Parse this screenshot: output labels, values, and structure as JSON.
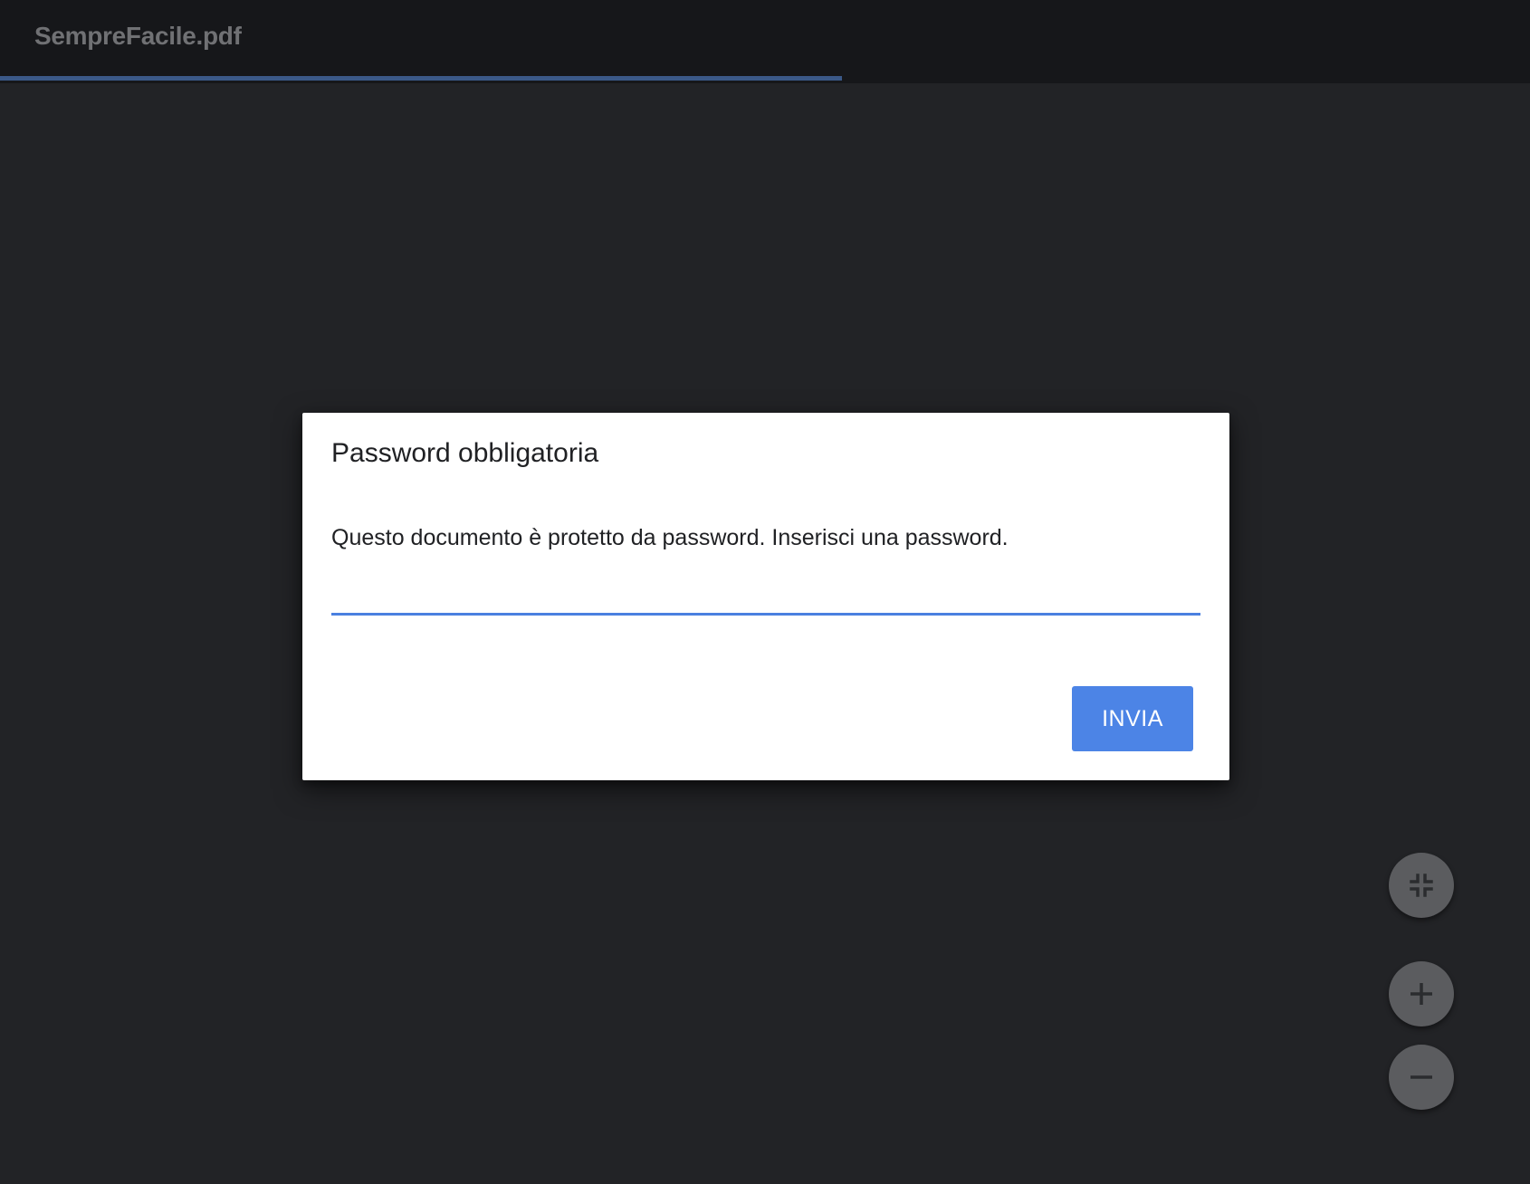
{
  "toolbar": {
    "document_title": "SempreFacile.pdf",
    "load_progress": 0.55,
    "progress_color": "#3b5988"
  },
  "dialog": {
    "title": "Password obbligatoria",
    "message": "Questo documento è protetto da password. Inserisci una password.",
    "password_value": "",
    "submit_label": "INVIA",
    "accent_color": "#4c84e6"
  },
  "zoom_controls": {
    "fit_icon": "fit-to-page-icon",
    "zoom_in_icon": "plus-icon",
    "zoom_out_icon": "minus-icon"
  }
}
